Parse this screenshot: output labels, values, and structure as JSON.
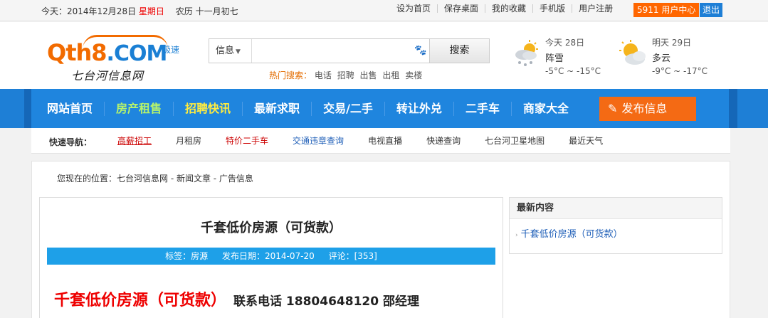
{
  "topbar": {
    "date_prefix": "今天：2014年12月28日",
    "weekday": "星期日",
    "lunar": "农历 十一月初七",
    "links": [
      "设为首页",
      "保存桌面",
      "我的收藏",
      "手机版",
      "用户注册"
    ],
    "user_center": "5911 用户中心",
    "logout": "退出"
  },
  "logo": {
    "main": "Qth8",
    "com": ".COM",
    "tag": "极速",
    "sub": "七台河信息网"
  },
  "search": {
    "category": "信息",
    "placeholder": "",
    "button": "搜索",
    "hot_label": "热门搜索：",
    "hot_words": [
      "电话",
      "招聘",
      "出售",
      "出租",
      "卖楼"
    ]
  },
  "weather": {
    "today": {
      "day": "今天 28日",
      "cond": "阵雪",
      "temp": "-5°C ~ -15°C"
    },
    "tomorrow": {
      "day": "明天 29日",
      "cond": "多云",
      "temp": "-9°C ~ -17°C"
    }
  },
  "nav": {
    "items": [
      "网站首页",
      "房产租售",
      "招聘快讯",
      "最新求职",
      "交易/二手",
      "转让外兑",
      "二手车",
      "商家大全"
    ],
    "publish": "发布信息"
  },
  "quick": {
    "label": "快速导航：",
    "links": [
      "高薪招工",
      "月租房",
      "特价二手车",
      "交通违章查询",
      "电视直播",
      "快递查询",
      "七台河卫星地图",
      "最近天气"
    ]
  },
  "breadcrumb": "您现在的位置：七台河信息网 - 新闻文章 - 广告信息",
  "article": {
    "title": "千套低价房源（可货款）",
    "tags": "标签：房源",
    "date": "发布日期：2014-07-20",
    "comments": "评论：[353]",
    "body_red": "千套低价房源（可货款）",
    "body_contact": "联系电话 18804648120  邵经理"
  },
  "side": {
    "header": "最新内容",
    "items": [
      "千套低价房源（可货款）"
    ]
  }
}
